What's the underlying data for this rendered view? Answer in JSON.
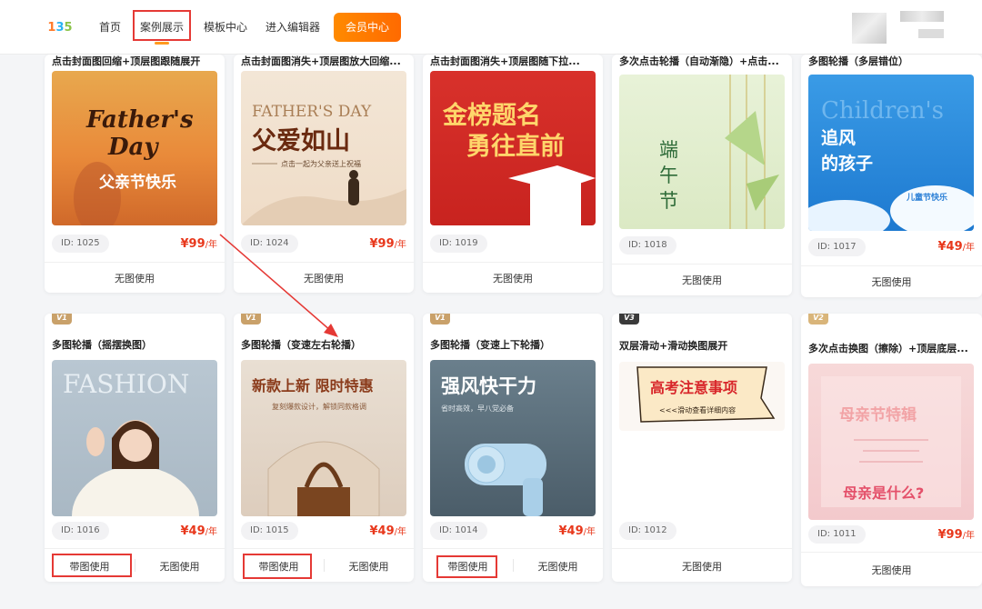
{
  "header": {
    "logo": [
      "1",
      "3",
      "5"
    ],
    "nav": [
      {
        "label": "首页"
      },
      {
        "label": "案例展示"
      },
      {
        "label": "模板中心"
      },
      {
        "label": "进入编辑器"
      }
    ],
    "vip_label": "会员中心",
    "active_color": "#e53935",
    "vip_color": "#ff7a00"
  },
  "cards": [
    {
      "title": "点击封面图回缩+顶层图跟随展开",
      "thumb_text": [
        "Father's",
        "Day",
        "父亲节快乐"
      ],
      "id": "ID: 1025",
      "price": "¥99",
      "unit": "/年",
      "btn": "无图使用"
    },
    {
      "title": "点击封面图消失+顶层图放大回缩...",
      "thumb_text": [
        "FATHER'S DAY",
        "父爱如山",
        "点击一起为父亲送上祝福"
      ],
      "id": "ID: 1024",
      "price": "¥99",
      "unit": "/年",
      "btn": "无图使用"
    },
    {
      "title": "点击封面图消失+顶层图随下拉...",
      "thumb_text": [
        "金榜题名",
        "勇往直前"
      ],
      "id": "ID: 1019",
      "price": "",
      "unit": "",
      "btn": "无图使用"
    },
    {
      "title": "多次点击轮播（自动渐隐）+点击...",
      "thumb_text": [
        "端",
        "午",
        "节"
      ],
      "id": "ID: 1018",
      "price": "",
      "unit": "",
      "btn": "无图使用"
    },
    {
      "title": "多图轮播（多层错位）",
      "thumb_text": [
        "Children's",
        "追风",
        "的孩子",
        "儿童节快乐"
      ],
      "id": "ID: 1017",
      "price": "¥49",
      "unit": "/年",
      "btn": "无图使用"
    },
    {
      "title": "多图轮播（摇摆换图）",
      "badge": "V1",
      "thumb_text": [
        "FASHION"
      ],
      "id": "ID: 1016",
      "price": "¥49",
      "unit": "/年",
      "btn_left": "带图使用",
      "btn_right": "无图使用"
    },
    {
      "title": "多图轮播（变速左右轮播）",
      "badge": "V1",
      "thumb_text": [
        "新款上新  限时特惠",
        "复刻爆款设计，解锁同款格调"
      ],
      "id": "ID: 1015",
      "price": "¥49",
      "unit": "/年",
      "btn_left": "带图使用",
      "btn_right": "无图使用"
    },
    {
      "title": "多图轮播（变速上下轮播）",
      "badge": "V1",
      "thumb_text": [
        "强风快干力",
        "省时高效，早八党必备"
      ],
      "id": "ID: 1014",
      "price": "¥49",
      "unit": "/年",
      "btn_left": "带图使用",
      "btn_right": "无图使用"
    },
    {
      "title": "双层滑动+滑动换图展开",
      "badge": "V3",
      "thumb_text": [
        "高考注意事项",
        "<<<滑动查看详细内容"
      ],
      "id": "ID: 1012",
      "price": "",
      "unit": "",
      "btn": "无图使用"
    },
    {
      "title": "多次点击换图（擦除）+顶层底层...",
      "badge": "V2",
      "thumb_text": [
        "母亲节特辑",
        "母亲是什么?"
      ],
      "id": "ID: 1011",
      "price": "¥99",
      "unit": "/年",
      "btn": "无图使用"
    }
  ],
  "colors": {
    "price": "#e8381c",
    "highlight_box": "#e53935",
    "badge_v1": "#c9a16a",
    "badge_v2": "#d9b57a",
    "badge_v3": "#3a3a3a"
  }
}
